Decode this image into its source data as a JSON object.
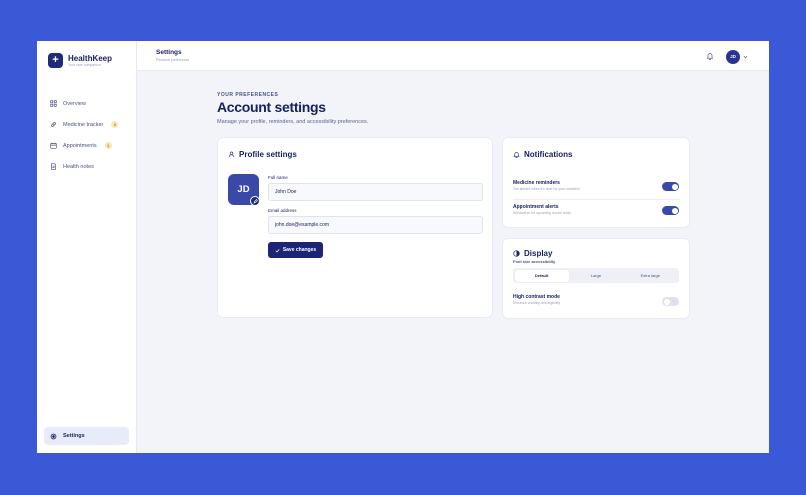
{
  "brand": {
    "name": "HealthKeep",
    "tagline": "Your care companion",
    "mark": "+"
  },
  "sidebar": {
    "items": [
      {
        "label": "Overview",
        "icon": "grid-icon"
      },
      {
        "label": "Medicine tracker",
        "icon": "pill-icon",
        "badge": "3"
      },
      {
        "label": "Appointments",
        "icon": "calendar-icon",
        "badge": "1"
      },
      {
        "label": "Health notes",
        "icon": "note-icon"
      }
    ],
    "settings": {
      "label": "Settings",
      "icon": "settings-icon"
    }
  },
  "topbar": {
    "title": "Settings",
    "subtitle": "Personal preferences",
    "avatar_initials": "JD"
  },
  "header": {
    "eyebrow": "YOUR PREFERENCES",
    "title": "Account settings",
    "subtitle": "Manage your profile, reminders, and accessibility preferences."
  },
  "profile": {
    "title": "Profile settings",
    "avatar_initials": "JD",
    "full_name_label": "Full name",
    "full_name_value": "John Doe",
    "email_label": "Email address",
    "email_value": "john.doe@example.com",
    "save_label": "Save changes"
  },
  "notifications": {
    "title": "Notifications",
    "items": [
      {
        "title": "Medicine reminders",
        "desc": "Get alerted when it's time for your medicine",
        "enabled": true
      },
      {
        "title": "Appointment alerts",
        "desc": "Reminders for upcoming doctor visits",
        "enabled": true
      }
    ]
  },
  "display": {
    "title": "Display",
    "font_size_label": "Font size accessibility",
    "font_sizes": [
      "Default",
      "Large",
      "Extra large"
    ],
    "selected_font_size": "Default",
    "contrast_title": "High contrast mode",
    "contrast_desc": "Enhance visibility and legibility",
    "contrast_enabled": false
  },
  "colors": {
    "background": "#3b59d6",
    "primary": "#1c2575",
    "accent": "#3a49a8",
    "badge": "#fce5b2"
  }
}
